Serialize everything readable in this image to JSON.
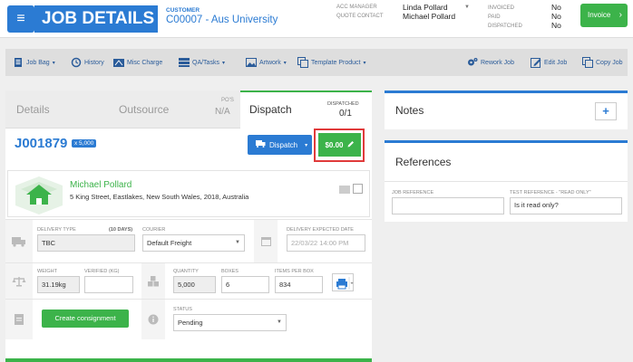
{
  "header": {
    "title": "JOB DETAILS",
    "customer_label": "CUSTOMER",
    "customer_value": "C00007 - Aus University",
    "acc_manager_label": "ACC MANAGER",
    "acc_manager_value": "Linda Pollard",
    "quote_contact_label": "QUOTE CONTACT",
    "quote_contact_value": "Michael Pollard",
    "invoiced_label": "INVOICED",
    "invoiced_value": "No",
    "paid_label": "PAID",
    "paid_value": "No",
    "dispatched_label": "DISPATCHED",
    "dispatched_value": "No",
    "invoice_button": "Invoice"
  },
  "toolbar": {
    "job_bag": "Job Bag",
    "history": "History",
    "misc_charge": "Misc Charge",
    "qa_tasks": "QA/Tasks",
    "artwork": "Artwork",
    "template_product": "Template Product",
    "rework_job": "Rework Job",
    "edit_job": "Edit Job",
    "copy_job": "Copy Job"
  },
  "tabs": {
    "details": "Details",
    "outsource": "Outsource",
    "pos_label": "PO'S",
    "pos_value": "N/A",
    "dispatch": "Dispatch",
    "dispatched_label": "DISPATCHED",
    "dispatched_value": "0/1"
  },
  "dispatch": {
    "job_number": "J001879",
    "qty_badge": "x 5,000",
    "dispatch_button": "Dispatch",
    "price_button": "$0.00",
    "contact_name": "Michael Pollard",
    "contact_address": "5 King Street, Eastlakes, New South Wales, 2018, Australia",
    "delivery_type_label": "DELIVERY TYPE",
    "delivery_type_days": "(10 DAYS)",
    "delivery_type_value": "TBC",
    "courier_label": "COURIER",
    "courier_value": "Default Freight",
    "delivery_date_label": "DELIVERY EXPECTED DATE",
    "delivery_date_placeholder": "22/03/22 14:00 PM",
    "weight_label": "WEIGHT",
    "weight_value": "31.19kg",
    "verified_label": "VERIFIED (KG)",
    "verified_value": "",
    "quantity_label": "QUANTITY",
    "quantity_value": "5,000",
    "boxes_label": "BOXES",
    "boxes_value": "6",
    "items_per_box_label": "ITEMS PER BOX",
    "items_per_box_value": "834",
    "create_consignment": "Create consignment",
    "status_label": "STATUS",
    "status_value": "Pending"
  },
  "notes": {
    "title": "Notes",
    "add": "+"
  },
  "references": {
    "title": "References",
    "job_ref_label": "JOB REFERENCE",
    "job_ref_value": "",
    "test_ref_label": "TEST REFERENCE - \"READ ONLY\"",
    "test_ref_value": "Is it read only?"
  },
  "colors": {
    "primary": "#2b7bd3",
    "success": "#3cb34a",
    "highlight": "#e03a3a"
  }
}
